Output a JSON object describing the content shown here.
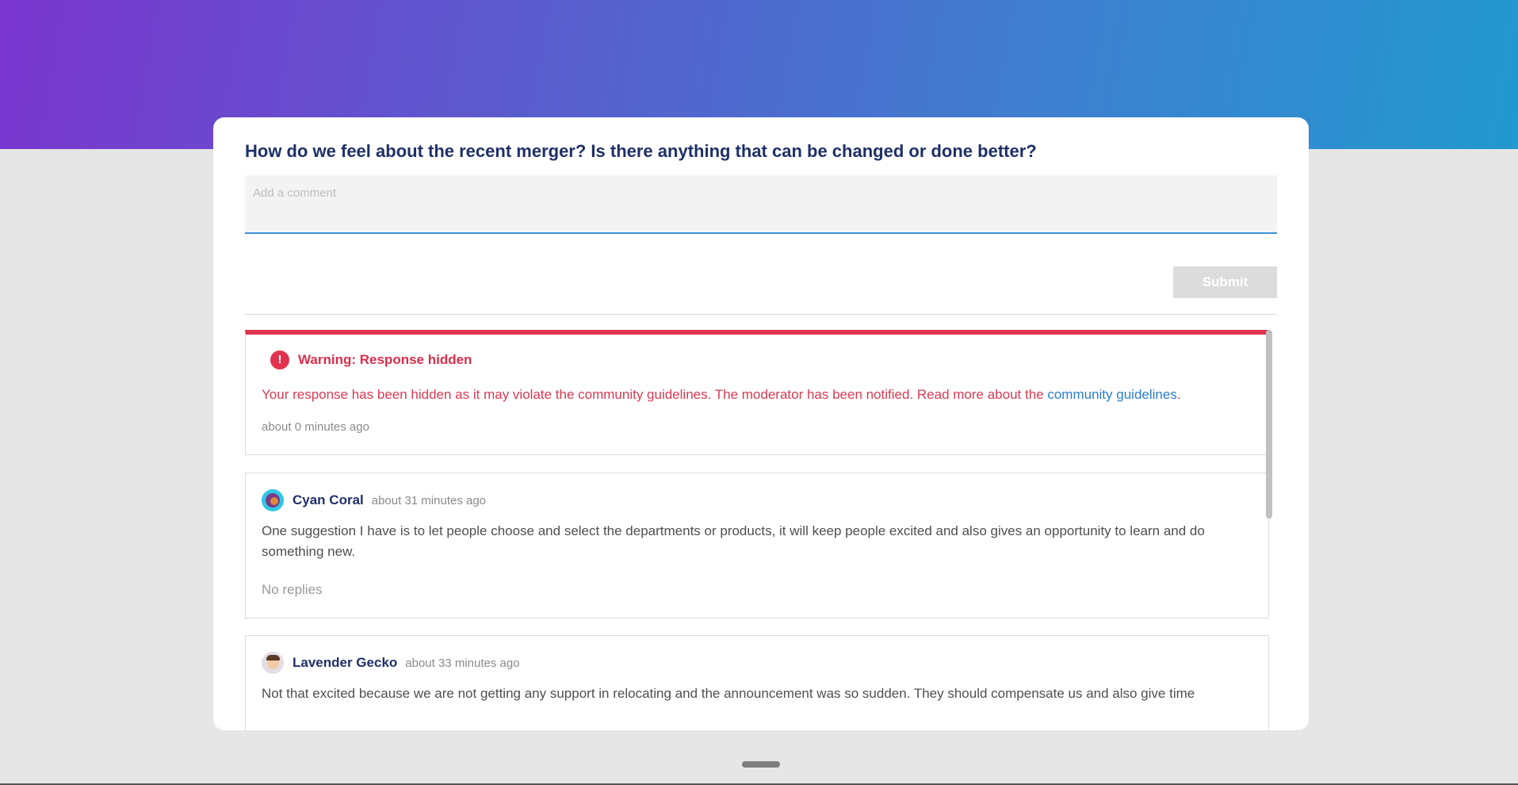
{
  "question": {
    "title": "How do we feel about the recent merger? Is there anything that can be changed or done better?"
  },
  "comment_input": {
    "placeholder": "Add a comment",
    "value": ""
  },
  "submit": {
    "label": "Submit"
  },
  "warning": {
    "icon": "!",
    "title": "Warning: Response hidden",
    "message": "Your response has been hidden as it may violate the community guidelines. The moderator has been notified. Read more about the ",
    "link_text": "community guidelines",
    "message_end": ".",
    "timestamp": "about 0 minutes ago",
    "color": "#e0334f"
  },
  "comments": [
    {
      "author": "Cyan Coral",
      "time": "about 31 minutes ago",
      "text": "One suggestion I have is to let people choose and select the departments or products, it will keep people excited and also gives an opportunity to learn and do something new.",
      "replies": "No replies"
    },
    {
      "author": "Lavender Gecko",
      "time": "about 33 minutes ago",
      "text": "Not that excited because we are not getting any support in relocating and the announcement was so sudden. They should compensate us and also give time"
    }
  ],
  "colors": {
    "accent": "#1f3068",
    "link": "#2a7ed1",
    "gradient_start": "#7a36cf",
    "gradient_end": "#2299cf"
  }
}
